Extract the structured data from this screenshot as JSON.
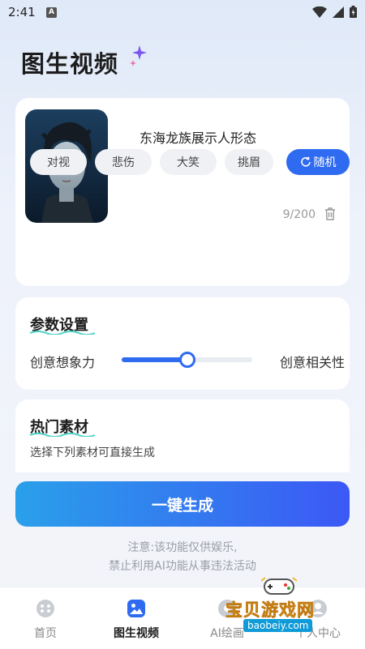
{
  "status_bar": {
    "time": "2:41",
    "app_badge": "A"
  },
  "page": {
    "title": "图生视频"
  },
  "prompt": {
    "text": "东海龙族展示人形态",
    "char_count": "9/200"
  },
  "chips": [
    {
      "label": "对视"
    },
    {
      "label": "悲伤"
    },
    {
      "label": "大笑"
    },
    {
      "label": "挑眉"
    },
    {
      "label": "随机",
      "selected": true
    }
  ],
  "params": {
    "title": "参数设置",
    "slider_left_label": "创意想象力",
    "slider_right_label": "创意相关性",
    "slider_value": 0.5
  },
  "hot_materials": {
    "title": "热门素材",
    "subtitle": "选择下列素材可直接生成"
  },
  "generate_button": {
    "label": "一键生成"
  },
  "notice": {
    "line1": "注意:该功能仅供娱乐,",
    "line2": "禁止利用AI功能从事违法活动"
  },
  "bottom_nav": [
    {
      "label": "首页",
      "icon": "home-dots-icon",
      "active": false
    },
    {
      "label": "图生视频",
      "icon": "image-icon",
      "active": true
    },
    {
      "label": "AI绘画",
      "icon": "paint-icon",
      "active": false
    },
    {
      "label": "个人中心",
      "icon": "user-icon",
      "active": false
    }
  ],
  "watermark": {
    "text": "宝贝游戏网",
    "url": "baobeiy.com"
  },
  "colors": {
    "accent": "#2f6bf0",
    "button_gradient_start": "#2aa0ea",
    "button_gradient_end": "#3c58f5"
  }
}
